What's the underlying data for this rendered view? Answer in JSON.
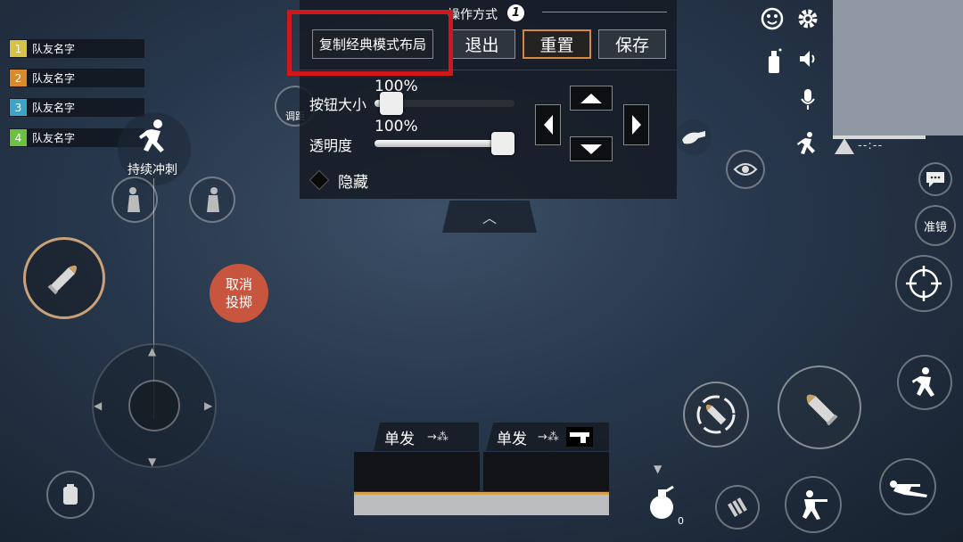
{
  "team": [
    {
      "num": "1",
      "name": "队友名字",
      "color": "#d9c145"
    },
    {
      "num": "2",
      "name": "队友名字",
      "color": "#d98b2c"
    },
    {
      "num": "3",
      "name": "队友名字",
      "color": "#3ca4c9"
    },
    {
      "num": "4",
      "name": "队友名字",
      "color": "#6cc043"
    }
  ],
  "panel": {
    "title": "操作方式",
    "title_badge": "1",
    "copy_label": "复制经典模式布局",
    "exit_label": "退出",
    "reset_label": "重置",
    "save_label": "保存",
    "size_label": "按钮大小",
    "size_value": "100%",
    "size_fraction": 0.12,
    "opacity_label": "透明度",
    "opacity_value": "100%",
    "opacity_fraction": 0.92,
    "hide_label": "隐藏"
  },
  "left": {
    "sprint_label": "持续冲刺",
    "adjust_label": "调距",
    "cancel_label": "取消\n投掷"
  },
  "right": {
    "aim_label": "准镜",
    "status_text": "--:--"
  },
  "bottom": {
    "fire_mode_1": "单发",
    "fire_mode_2": "单发",
    "grenade_count": "0"
  },
  "colors": {
    "highlight": "#d0181c",
    "reset_border": "#d8883c",
    "cancel_bg": "#c8553d"
  }
}
